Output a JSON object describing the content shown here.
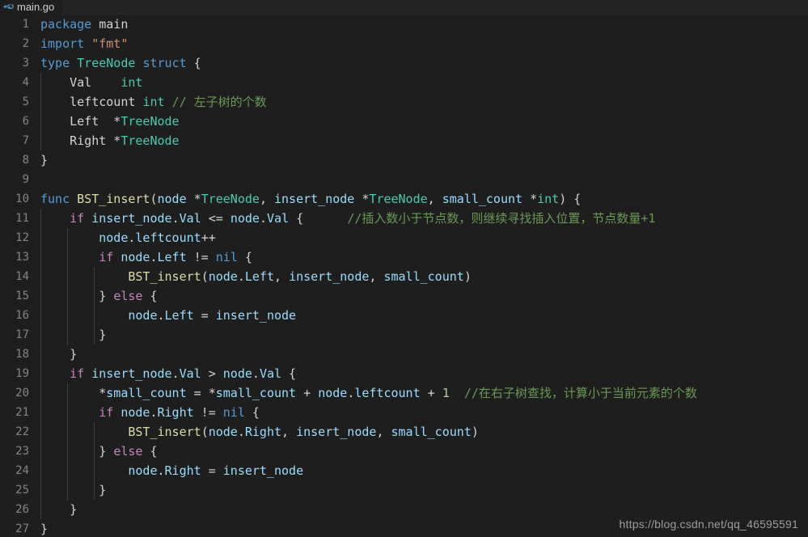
{
  "window": {
    "background": "#1e1e1e",
    "tabbar_background": "#252526"
  },
  "tabbar": {
    "active_tab": {
      "label": "main.go",
      "icon": "go-file-icon",
      "icon_color": "#4d9fd6"
    }
  },
  "colors": {
    "keyword": "#569cd6",
    "control": "#c586c0",
    "type": "#4ec9b0",
    "function": "#dcdcaa",
    "variable": "#9cdcfe",
    "string": "#ce9178",
    "number": "#b5cea8",
    "comment": "#6a9955",
    "plain": "#d4d4d4",
    "line_number": "#858585",
    "indent_guide": "#404040"
  },
  "editor": {
    "language": "go",
    "first_line": 1,
    "last_line": 27,
    "line_numbers": [
      "1",
      "2",
      "3",
      "4",
      "5",
      "6",
      "7",
      "8",
      "9",
      "10",
      "11",
      "12",
      "13",
      "14",
      "15",
      "16",
      "17",
      "18",
      "19",
      "20",
      "21",
      "22",
      "23",
      "24",
      "25",
      "26",
      "27"
    ],
    "lines": [
      {
        "n": "1",
        "text": "package main"
      },
      {
        "n": "2",
        "text": "import \"fmt\""
      },
      {
        "n": "3",
        "text": "type TreeNode struct {"
      },
      {
        "n": "4",
        "text": "    Val    int"
      },
      {
        "n": "5",
        "text": "    leftcount int // 左子树的个数"
      },
      {
        "n": "6",
        "text": "    Left  *TreeNode"
      },
      {
        "n": "7",
        "text": "    Right *TreeNode"
      },
      {
        "n": "8",
        "text": "}"
      },
      {
        "n": "9",
        "text": ""
      },
      {
        "n": "10",
        "text": "func BST_insert(node *TreeNode, insert_node *TreeNode, small_count *int) {"
      },
      {
        "n": "11",
        "text": "    if insert_node.Val <= node.Val {      //插入数小于节点数，则继续寻找插入位置，节点数量+1"
      },
      {
        "n": "12",
        "text": "        node.leftcount++"
      },
      {
        "n": "13",
        "text": "        if node.Left != nil {"
      },
      {
        "n": "14",
        "text": "            BST_insert(node.Left, insert_node, small_count)"
      },
      {
        "n": "15",
        "text": "        } else {"
      },
      {
        "n": "16",
        "text": "            node.Left = insert_node"
      },
      {
        "n": "17",
        "text": "        }"
      },
      {
        "n": "18",
        "text": "    }"
      },
      {
        "n": "19",
        "text": "    if insert_node.Val > node.Val {"
      },
      {
        "n": "20",
        "text": "        *small_count = *small_count + node.leftcount + 1  //在右子树查找，计算小于当前元素的个数"
      },
      {
        "n": "21",
        "text": "        if node.Right != nil {"
      },
      {
        "n": "22",
        "text": "            BST_insert(node.Right, insert_node, small_count)"
      },
      {
        "n": "23",
        "text": "        } else {"
      },
      {
        "n": "24",
        "text": "            node.Right = insert_node"
      },
      {
        "n": "25",
        "text": "        }"
      },
      {
        "n": "26",
        "text": "    }"
      },
      {
        "n": "27",
        "text": "}"
      }
    ],
    "comments": {
      "line5": "// 左子树的个数",
      "line11": "//插入数小于节点数，则继续寻找插入位置，节点数量+1",
      "line20": "//在右子树查找，计算小于当前元素的个数"
    }
  },
  "watermark": {
    "text": "https://blog.csdn.net/qq_46595591"
  }
}
